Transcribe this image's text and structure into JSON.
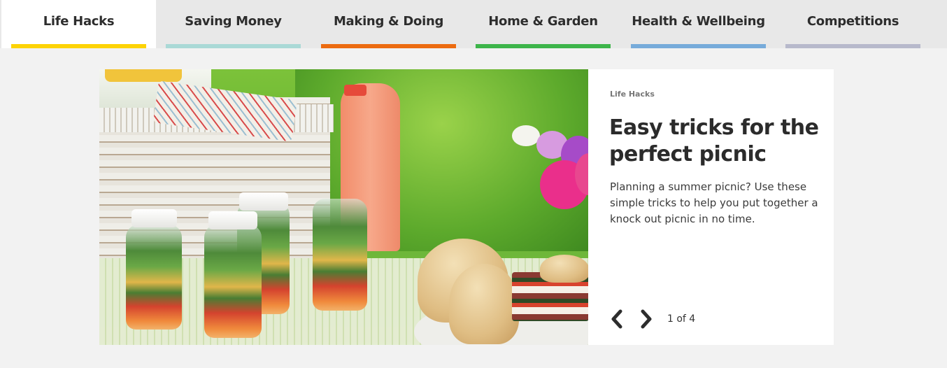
{
  "nav_tabs": [
    {
      "label": "Life Hacks",
      "color": "#fdd305",
      "active": true
    },
    {
      "label": "Saving Money",
      "color": "#aad9d6",
      "active": false
    },
    {
      "label": "Making & Doing",
      "color": "#ec6b10",
      "active": false
    },
    {
      "label": "Home & Garden",
      "color": "#3db54a",
      "active": false
    },
    {
      "label": "Health & Wellbeing",
      "color": "#77abda",
      "active": false
    },
    {
      "label": "Competitions",
      "color": "#b7b9cb",
      "active": false
    }
  ],
  "carousel": {
    "image_alt": "Picnic basket, salad jars, pink lemonade bottle, flowers and stuffed bread loaf on a table",
    "category": "Life Hacks",
    "title": "Easy tricks for the perfect picnic",
    "description": "Planning a summer picnic? Use these simple tricks to help you put together a knock out picnic in no time.",
    "prev_icon": "chevron-left-icon",
    "next_icon": "chevron-right-icon",
    "current": 1,
    "total": 4,
    "counter": "1 of 4"
  }
}
